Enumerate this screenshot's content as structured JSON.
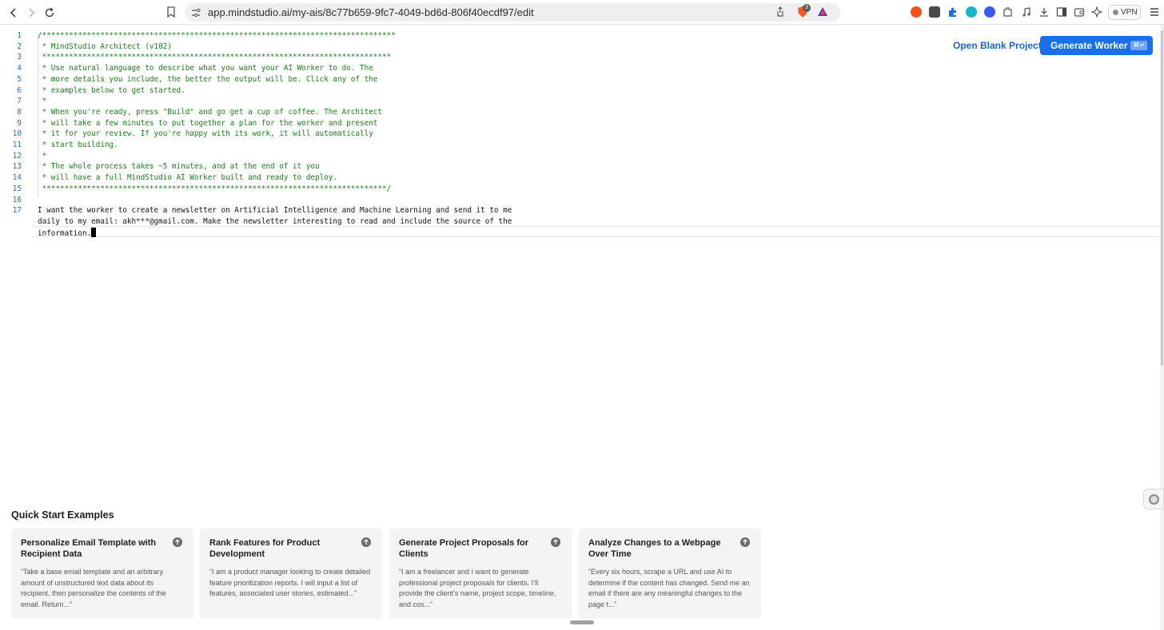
{
  "browser": {
    "url": "app.mindstudio.ai/my-ais/8c77b659-9fc7-4049-bd6d-806f40ecdf97/edit",
    "brave_badge": "3",
    "vpn_label": "VPN",
    "extensions": [
      "brave-rewards-icon",
      "w-extension-icon",
      "puzzle-extension-icon",
      "circle-extension-icon",
      "x-extension-icon",
      "extensions-icon",
      "music-icon",
      "download-icon",
      "sidebar-icon",
      "wallet-icon",
      "leo-ai-icon"
    ]
  },
  "editor": {
    "lines": [
      {
        "n": "1",
        "text": "/*******************************************************************************",
        "kind": "comment"
      },
      {
        "n": "2",
        "text": " * MindStudio Architect (v102)",
        "kind": "comment"
      },
      {
        "n": "3",
        "text": " ******************************************************************************",
        "kind": "comment"
      },
      {
        "n": "4",
        "text": " * Use natural language to describe what you want your AI Worker to do. The",
        "kind": "comment"
      },
      {
        "n": "5",
        "text": " * more details you include, the better the output will be. Click any of the",
        "kind": "comment"
      },
      {
        "n": "6",
        "text": " * examples below to get started.",
        "kind": "comment"
      },
      {
        "n": "7",
        "text": " *",
        "kind": "comment"
      },
      {
        "n": "8",
        "text": " * When you're ready, press \"Build\" and go get a cup of coffee. The Architect",
        "kind": "comment"
      },
      {
        "n": "9",
        "text": " * will take a few minutes to put together a plan for the worker and present",
        "kind": "comment"
      },
      {
        "n": "10",
        "text": " * it for your review. If you're happy with its work, it will automatically",
        "kind": "comment"
      },
      {
        "n": "11",
        "text": " * start building.",
        "kind": "comment"
      },
      {
        "n": "12",
        "text": " *",
        "kind": "comment"
      },
      {
        "n": "13",
        "text": " * The whole process takes ~5 minutes, and at the end of it you",
        "kind": "comment"
      },
      {
        "n": "14",
        "text": " * will have a full MindStudio AI Worker built and ready to deploy.",
        "kind": "comment"
      },
      {
        "n": "15",
        "text": " *****************************************************************************/",
        "kind": "comment"
      },
      {
        "n": "16",
        "text": "",
        "kind": "plain"
      },
      {
        "n": "17",
        "text": "I want the worker to create a newsletter on Artificial Intelligence and Machine Learning and send it to me",
        "kind": "plain"
      },
      {
        "n": "",
        "text": "daily to my email: akh***@gmail.com. Make the newsletter interesting to read and include the source of the",
        "kind": "plain"
      },
      {
        "n": "",
        "text": "information.",
        "kind": "plain",
        "cursor": true
      }
    ]
  },
  "actions": {
    "open_blank": "Open Blank Project",
    "generate": "Generate Worker",
    "generate_shortcut": "⌘↵"
  },
  "quick_start": {
    "title": "Quick Start Examples",
    "cards": [
      {
        "title": "Personalize Email Template with Recipient Data",
        "desc": "“Take a base email template and an arbitrary amount of unstructured text data about its recipient, then personalize the contents of the email. Return...”"
      },
      {
        "title": "Rank Features for Product Development",
        "desc": "“I am a product manager looking to create detailed feature prioritization reports. I will input a list of features, associated user stories, estimated...”"
      },
      {
        "title": "Generate Project Proposals for Clients",
        "desc": "“I am a freelancer and I want to generate professional project proposals for clients. I’ll provide the client’s name, project scope, timeline, and cos...”"
      },
      {
        "title": "Analyze Changes to a Webpage Over Time",
        "desc": "“Every six hours, scrape a URL and use AI to determine if the content has changed. Send me an email if there are any meaningful changes to the page t...”"
      }
    ]
  },
  "colors": {
    "accent": "#1a6fe8",
    "comment": "#1a7f1a",
    "line_number": "#2e6fb5"
  }
}
